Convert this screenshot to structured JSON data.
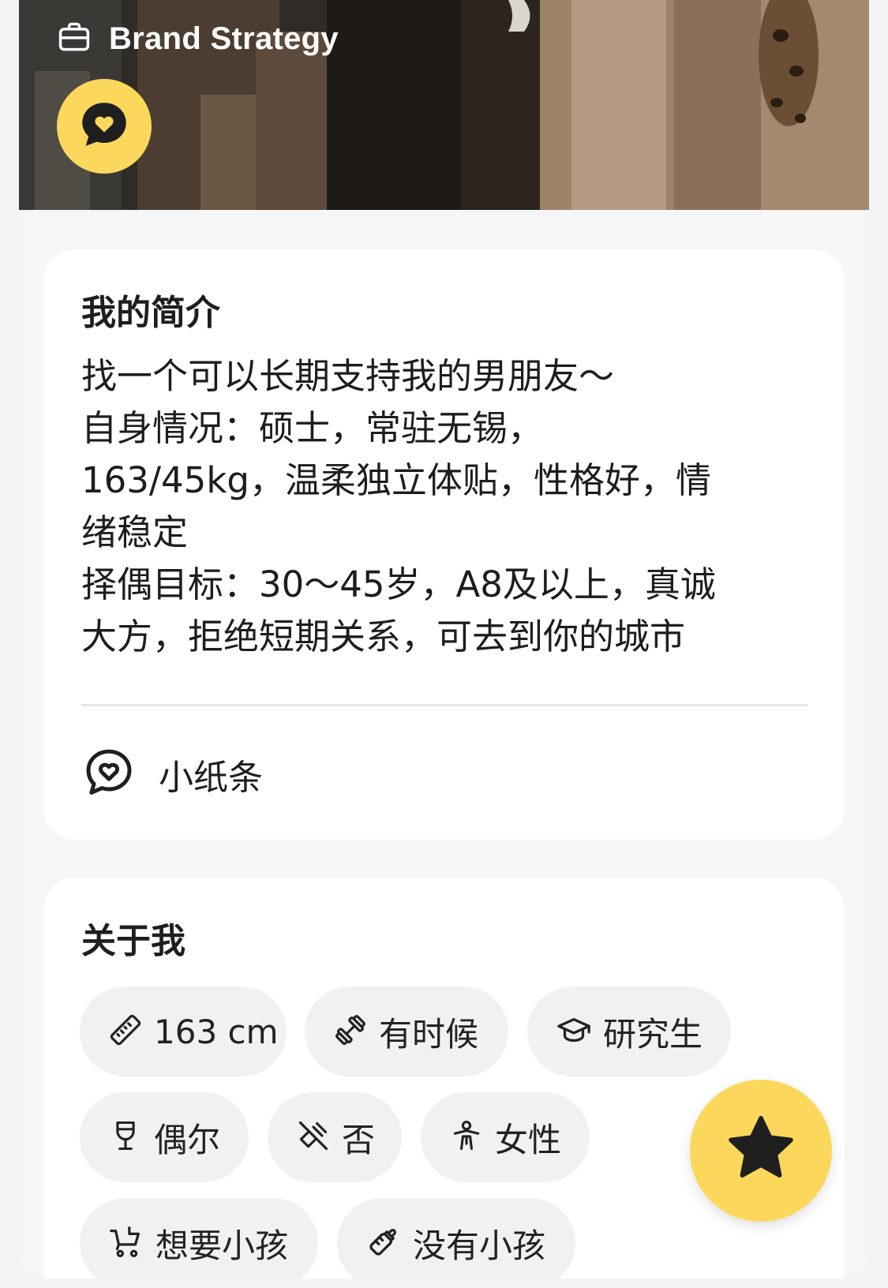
{
  "header": {
    "work_label": "Brand Strategy",
    "icons": {
      "work": "briefcase-icon",
      "note": "chat-heart-icon"
    }
  },
  "bio": {
    "title": "我的简介",
    "lines": [
      "找一个可以长期支持我的男朋友～",
      "自身情况：硕士，常驻无锡，",
      "163/45kg，温柔独立体贴，性格好，情",
      "绪稳定",
      "择偶目标：30～45岁，A8及以上，真诚",
      "大方，拒绝短期关系，可去到你的城市"
    ],
    "note_label": "小纸条"
  },
  "about": {
    "title": "关于我",
    "chips": [
      {
        "icon": "ruler-icon",
        "label": "163 cm"
      },
      {
        "icon": "dumbbell-icon",
        "label": "有时候"
      },
      {
        "icon": "graduation-cap-icon",
        "label": "研究生"
      },
      {
        "icon": "wine-glass-icon",
        "label": "偶尔"
      },
      {
        "icon": "no-smoking-icon",
        "label": "否"
      },
      {
        "icon": "gender-icon",
        "label": "女性"
      },
      {
        "icon": "stroller-icon",
        "label": "想要小孩"
      },
      {
        "icon": "baby-bottle-icon",
        "label": "没有小孩"
      }
    ]
  },
  "colors": {
    "accent": "#fbd85b",
    "chip_bg": "#f1f1f1",
    "text": "#1f1f1f"
  }
}
